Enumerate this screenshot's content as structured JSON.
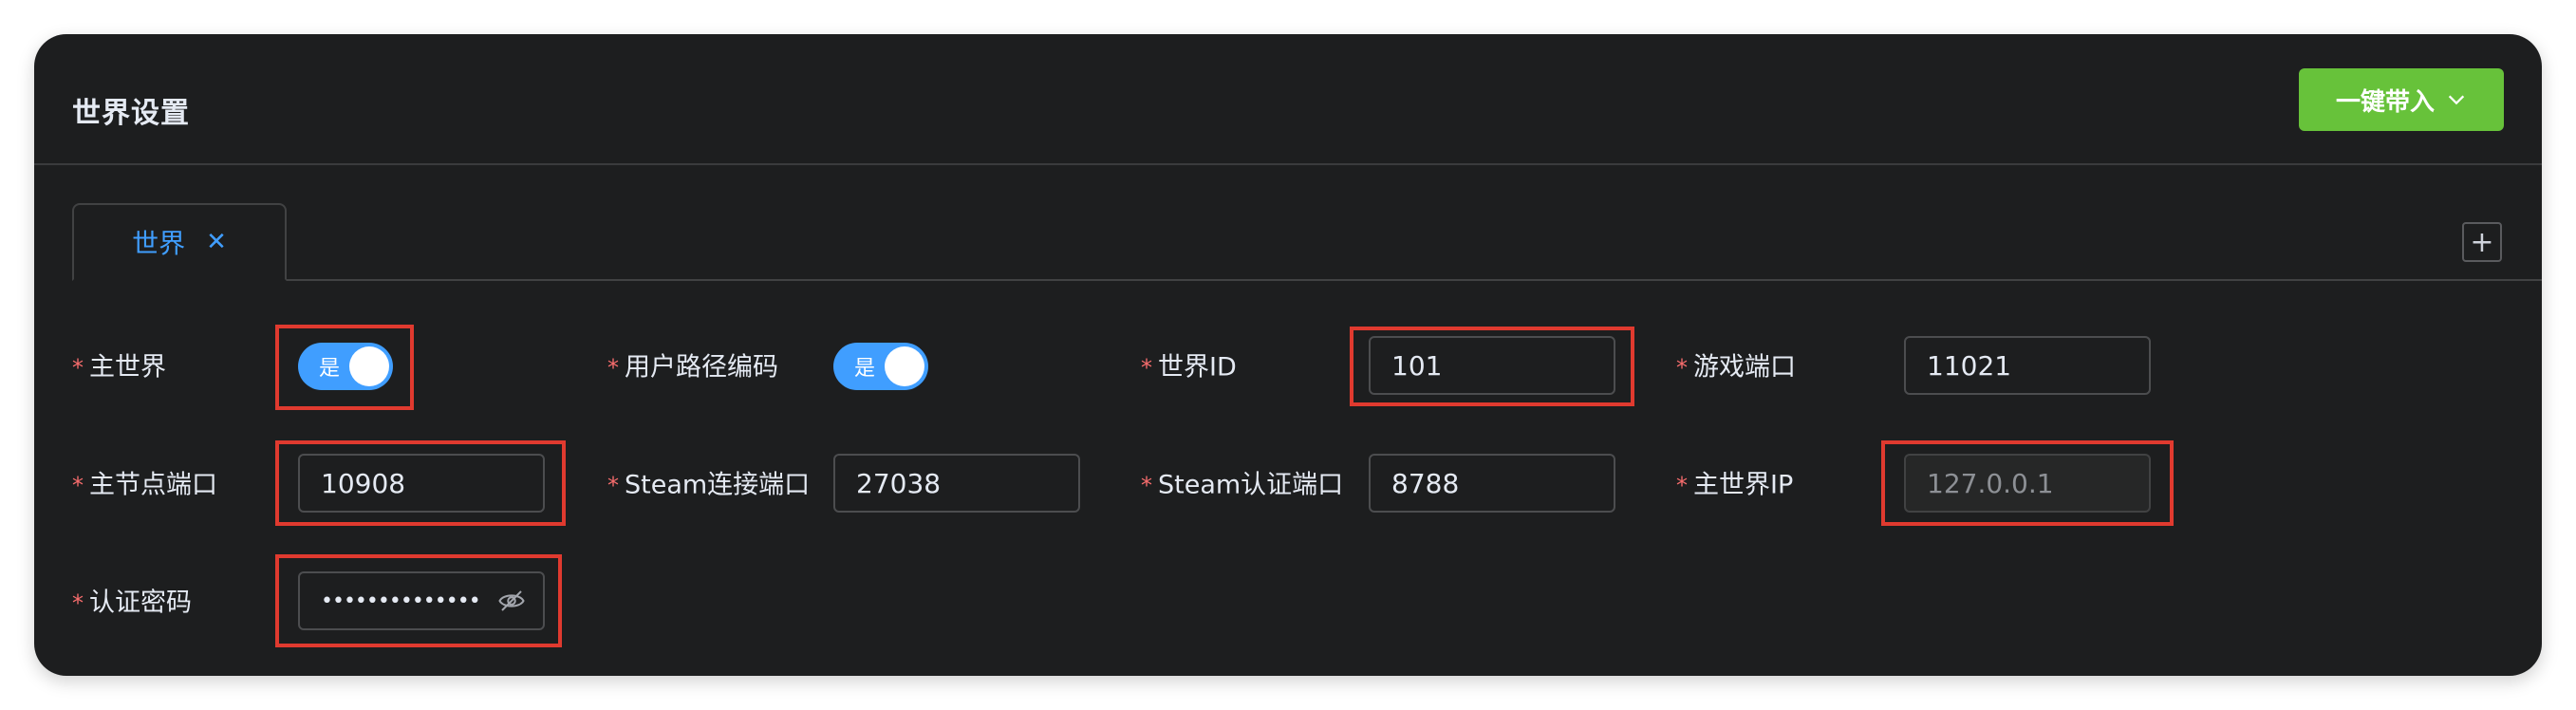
{
  "header": {
    "title": "世界设置",
    "bring_in_label": "一键带入"
  },
  "tabs": [
    {
      "label": "世界"
    }
  ],
  "colors": {
    "accent": "#409eff",
    "success": "#67c23a",
    "required": "#f56c6c",
    "highlight": "#e03a2f",
    "panel_bg": "#1d1e1f"
  },
  "form": {
    "required_mark": "*",
    "main_world": {
      "label": "主世界",
      "switch_text": "是",
      "value": true
    },
    "user_path_encoding": {
      "label": "用户路径编码",
      "switch_text": "是",
      "value": true
    },
    "world_id": {
      "label": "世界ID",
      "value": "101"
    },
    "game_port": {
      "label": "游戏端口",
      "value": "11021"
    },
    "master_node_port": {
      "label": "主节点端口",
      "value": "10908"
    },
    "steam_connect_port": {
      "label": "Steam连接端口",
      "value": "27038"
    },
    "steam_auth_port": {
      "label": "Steam认证端口",
      "value": "8788"
    },
    "main_world_ip": {
      "label": "主世界IP",
      "value": "127.0.0.1",
      "disabled": true
    },
    "auth_password": {
      "label": "认证密码",
      "masked_value": "••••••••••••••"
    }
  }
}
